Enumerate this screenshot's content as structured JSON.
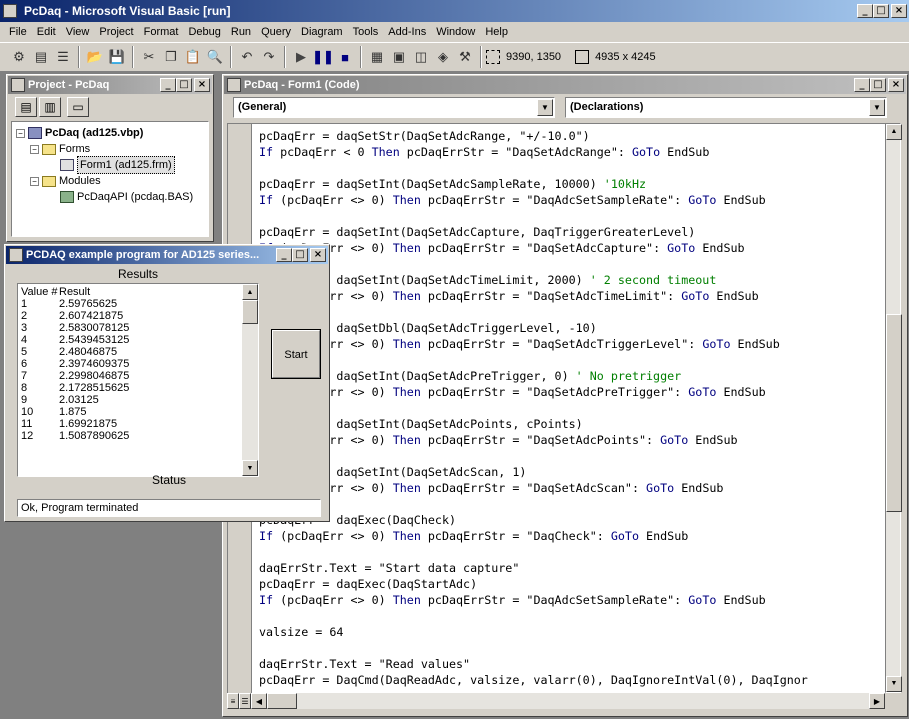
{
  "app": {
    "title": "PcDaq - Microsoft Visual Basic [run]"
  },
  "menu": [
    "File",
    "Edit",
    "View",
    "Project",
    "Format",
    "Debug",
    "Run",
    "Query",
    "Diagram",
    "Tools",
    "Add-Ins",
    "Window",
    "Help"
  ],
  "toolbar": {
    "position": "9390, 1350",
    "size": "4935 x 4245"
  },
  "project": {
    "title": "Project - PcDaq",
    "root": "PcDaq (ad125.vbp)",
    "forms_folder": "Forms",
    "form1": "Form1 (ad125.frm)",
    "modules_folder": "Modules",
    "module1": "PcDaqAPI (pcdaq.BAS)"
  },
  "code_window": {
    "title": "PcDaq - Form1 (Code)",
    "object_combo": "(General)",
    "proc_combo": "(Declarations)",
    "lines": [
      [
        [
          "t",
          "pcDaqErr = daqSetStr(DaqSetAdcRange, \"+/-10.0\")"
        ]
      ],
      [
        [
          "k",
          "If"
        ],
        [
          "t",
          " pcDaqErr < 0 "
        ],
        [
          "k",
          "Then"
        ],
        [
          "t",
          " pcDaqErrStr = \"DaqSetAdcRange\": "
        ],
        [
          "k",
          "GoTo"
        ],
        [
          "t",
          " EndSub"
        ]
      ],
      [
        [
          "t",
          ""
        ]
      ],
      [
        [
          "t",
          "pcDaqErr = daqSetInt(DaqSetAdcSampleRate, 10000) "
        ],
        [
          "c",
          "'10kHz"
        ]
      ],
      [
        [
          "k",
          "If"
        ],
        [
          "t",
          " (pcDaqErr <> 0) "
        ],
        [
          "k",
          "Then"
        ],
        [
          "t",
          " pcDaqErrStr = \"DaqAdcSetSampleRate\": "
        ],
        [
          "k",
          "GoTo"
        ],
        [
          "t",
          " EndSub"
        ]
      ],
      [
        [
          "t",
          ""
        ]
      ],
      [
        [
          "t",
          "pcDaqErr = daqSetInt(DaqSetAdcCapture, DaqTriggerGreaterLevel)"
        ]
      ],
      [
        [
          "k",
          "If"
        ],
        [
          "t",
          " (pcDaqErr <> 0) "
        ],
        [
          "k",
          "Then"
        ],
        [
          "t",
          " pcDaqErrStr = \"DaqSetAdcCapture\": "
        ],
        [
          "k",
          "GoTo"
        ],
        [
          "t",
          " EndSub"
        ]
      ],
      [
        [
          "t",
          ""
        ]
      ],
      [
        [
          "t",
          "pcDaqErr = daqSetInt(DaqSetAdcTimeLimit, 2000) "
        ],
        [
          "c",
          "' 2 second timeout"
        ]
      ],
      [
        [
          "k",
          "If"
        ],
        [
          "t",
          " (pcDaqErr <> 0) "
        ],
        [
          "k",
          "Then"
        ],
        [
          "t",
          " pcDaqErrStr = \"DaqSetAdcTimeLimit\": "
        ],
        [
          "k",
          "GoTo"
        ],
        [
          "t",
          " EndSub"
        ]
      ],
      [
        [
          "t",
          ""
        ]
      ],
      [
        [
          "t",
          "pcDaqErr = daqSetDbl(DaqSetAdcTriggerLevel, -10)"
        ]
      ],
      [
        [
          "k",
          "If"
        ],
        [
          "t",
          " (pcDaqErr <> 0) "
        ],
        [
          "k",
          "Then"
        ],
        [
          "t",
          " pcDaqErrStr = \"DaqSetAdcTriggerLevel\": "
        ],
        [
          "k",
          "GoTo"
        ],
        [
          "t",
          " EndSub"
        ]
      ],
      [
        [
          "t",
          ""
        ]
      ],
      [
        [
          "t",
          "pcDaqErr = daqSetInt(DaqSetAdcPreTrigger, 0) "
        ],
        [
          "c",
          "' No pretrigger"
        ]
      ],
      [
        [
          "k",
          "If"
        ],
        [
          "t",
          " (pcDaqErr <> 0) "
        ],
        [
          "k",
          "Then"
        ],
        [
          "t",
          " pcDaqErrStr = \"DaqSetAdcPreTrigger\": "
        ],
        [
          "k",
          "GoTo"
        ],
        [
          "t",
          " EndSub"
        ]
      ],
      [
        [
          "t",
          ""
        ]
      ],
      [
        [
          "t",
          "pcDaqErr = daqSetInt(DaqSetAdcPoints, cPoints)"
        ]
      ],
      [
        [
          "k",
          "If"
        ],
        [
          "t",
          " (pcDaqErr <> 0) "
        ],
        [
          "k",
          "Then"
        ],
        [
          "t",
          " pcDaqErrStr = \"DaqSetAdcPoints\": "
        ],
        [
          "k",
          "GoTo"
        ],
        [
          "t",
          " EndSub"
        ]
      ],
      [
        [
          "t",
          ""
        ]
      ],
      [
        [
          "t",
          "pcDaqErr = daqSetInt(DaqSetAdcScan, 1)"
        ]
      ],
      [
        [
          "k",
          "If"
        ],
        [
          "t",
          " (pcDaqErr <> 0) "
        ],
        [
          "k",
          "Then"
        ],
        [
          "t",
          " pcDaqErrStr = \"DaqSetAdcScan\": "
        ],
        [
          "k",
          "GoTo"
        ],
        [
          "t",
          " EndSub"
        ]
      ],
      [
        [
          "t",
          ""
        ]
      ],
      [
        [
          "t",
          "pcDaqErr = daqExec(DaqCheck)"
        ]
      ],
      [
        [
          "k",
          "If"
        ],
        [
          "t",
          " (pcDaqErr <> 0) "
        ],
        [
          "k",
          "Then"
        ],
        [
          "t",
          " pcDaqErrStr = \"DaqCheck\": "
        ],
        [
          "k",
          "GoTo"
        ],
        [
          "t",
          " EndSub"
        ]
      ],
      [
        [
          "t",
          ""
        ]
      ],
      [
        [
          "t",
          "daqErrStr.Text = \"Start data capture\""
        ]
      ],
      [
        [
          "t",
          "pcDaqErr = daqExec(DaqStartAdc)"
        ]
      ],
      [
        [
          "k",
          "If"
        ],
        [
          "t",
          " (pcDaqErr <> 0) "
        ],
        [
          "k",
          "Then"
        ],
        [
          "t",
          " pcDaqErrStr = \"DaqAdcSetSampleRate\": "
        ],
        [
          "k",
          "GoTo"
        ],
        [
          "t",
          " EndSub"
        ]
      ],
      [
        [
          "t",
          ""
        ]
      ],
      [
        [
          "t",
          "valsize = 64"
        ]
      ],
      [
        [
          "t",
          ""
        ]
      ],
      [
        [
          "t",
          "daqErrStr.Text = \"Read values\""
        ]
      ],
      [
        [
          "t",
          "pcDaqErr = DaqCmd(DaqReadAdc, valsize, valarr(0), DaqIgnoreIntVal(0), DaqIgnor"
        ]
      ]
    ]
  },
  "dialog": {
    "title": "PCDAQ example program for AD125 series...",
    "results_label": "Results",
    "list_header": [
      "Value #",
      "Result"
    ],
    "rows": [
      [
        "1",
        "2.59765625"
      ],
      [
        "2",
        "2.607421875"
      ],
      [
        "3",
        "2.5830078125"
      ],
      [
        "4",
        "2.5439453125"
      ],
      [
        "5",
        "2.48046875"
      ],
      [
        "6",
        "2.3974609375"
      ],
      [
        "7",
        "2.2998046875"
      ],
      [
        "8",
        "2.1728515625"
      ],
      [
        "9",
        "2.03125"
      ],
      [
        "10",
        "1.875"
      ],
      [
        "11",
        "1.69921875"
      ],
      [
        "12",
        "1.5087890625"
      ]
    ],
    "start_button": "Start",
    "status_label": "Status",
    "status_value": "Ok, Program terminated"
  }
}
